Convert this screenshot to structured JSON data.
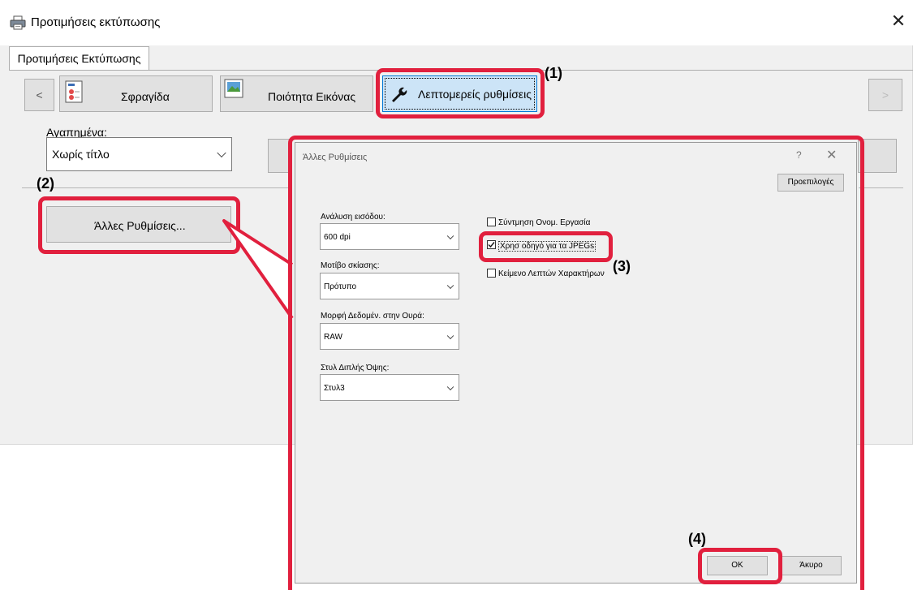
{
  "window": {
    "title": "Προτιμήσεις εκτύπωσης",
    "close_glyph": "✕",
    "tab": "Προτιμήσεις Εκτύπωσης"
  },
  "nav": {
    "prev": "<",
    "next": ">",
    "tabs": [
      {
        "label": "Σφραγίδα",
        "icon": "stamp-icon"
      },
      {
        "label": "Ποιότητα Εικόνας",
        "icon": "image-quality-icon"
      },
      {
        "label": "Λεπτομερείς ρυθμίσεις",
        "icon": "wrench-icon"
      }
    ]
  },
  "favorites": {
    "label": "Αγαπημένα:",
    "value": "Χωρίς τίτλο"
  },
  "other_settings_button": "Άλλες Ρυθμίσεις...",
  "callouts": {
    "c1": "(1)",
    "c2": "(2)",
    "c3": "(3)",
    "c4": "(4)"
  },
  "dialog": {
    "title": "Άλλες Ρυθμίσεις",
    "help": "?",
    "close": "✕",
    "defaults_button": "Προεπιλογές",
    "fields": [
      {
        "label": "Ανάλυση εισόδου:",
        "value": "600 dpi"
      },
      {
        "label": "Μοτίβο σκίασης:",
        "value": "Πρότυπο"
      },
      {
        "label": "Μορφή Δεδομέν. στην Ουρά:",
        "value": "RAW"
      },
      {
        "label": "Στυλ Διπλής Όψης:",
        "value": "Στυλ3"
      }
    ],
    "checkboxes": [
      {
        "label": "Σύντμηση Ονομ. Εργασία",
        "checked": false
      },
      {
        "label": "Χρησ οδηγό για τα JPEGs",
        "checked": true
      },
      {
        "label": "Κείμενο Λεπτών Χαρακτήρων",
        "checked": false
      }
    ],
    "ok": "OK",
    "cancel": "Άκυρο"
  },
  "colors": {
    "callout_red": "#e1203e",
    "button_gray": "#e1e1e1",
    "window_bg": "#f0f0f0"
  }
}
